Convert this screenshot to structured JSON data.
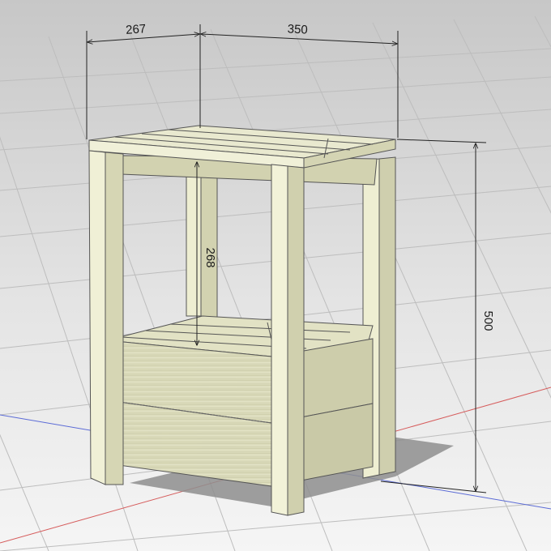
{
  "dimensions": {
    "depth": "267",
    "width": "350",
    "shelf_height": "268",
    "total_height": "500"
  },
  "colors": {
    "background_top": "#c9c9c9",
    "background_bottom": "#f2f2f2",
    "grid_line": "#b8b8b8",
    "axis_red": "#d45a5a",
    "axis_blue": "#5a6ad4",
    "wood_light": "#eeeed0",
    "wood_mid": "#dcdcba",
    "wood_dark": "#c2c29e",
    "edge": "#555555",
    "dimension_line": "#222222"
  }
}
